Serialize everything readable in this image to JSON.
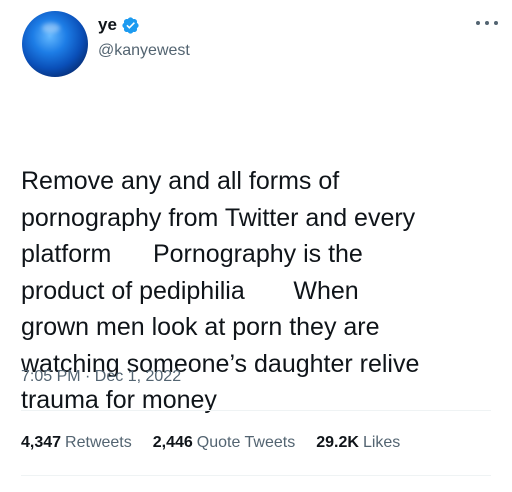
{
  "author": {
    "display_name": "ye",
    "handle": "@kanyewest",
    "verified": true,
    "avatar_icon": "blue-globe-avatar"
  },
  "tweet": {
    "lines": [
      "Remove any and all forms of",
      "pornography from Twitter and every",
      "platform      Pornography is the",
      "product of pediphilia       When",
      "grown men look at porn they are",
      "watching someone’s daughter relive",
      "trauma for money"
    ],
    "timestamp": "7:05 PM · Dec 1, 2022"
  },
  "stats": {
    "retweets": {
      "count": "4,347",
      "label": "Retweets"
    },
    "quote_tweets": {
      "count": "2,446",
      "label": "Quote Tweets"
    },
    "likes": {
      "count": "29.2K",
      "label": "Likes"
    }
  },
  "colors": {
    "text_primary": "#0f1419",
    "text_secondary": "#536471",
    "verified_blue": "#1d9bf0",
    "divider": "#eff3f4"
  }
}
